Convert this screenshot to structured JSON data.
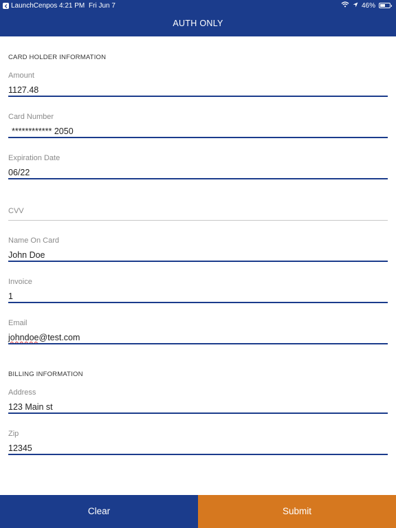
{
  "status_bar": {
    "back_app": "LaunchCenpos",
    "time": "4:21 PM",
    "date": "Fri Jun 7",
    "battery": "46%",
    "battery_level": 0.46
  },
  "header": {
    "title": "AUTH ONLY"
  },
  "card_section": {
    "heading": "CARD HOLDER INFORMATION"
  },
  "fields": {
    "amount": {
      "label": "Amount",
      "value": "1127.48"
    },
    "card_number": {
      "label": "Card Number",
      "value": "************ 2050"
    },
    "expiration": {
      "label": "Expiration Date",
      "value": "06/22"
    },
    "cvv": {
      "label": "CVV",
      "value": ""
    },
    "name": {
      "label": "Name On Card",
      "value": "John Doe"
    },
    "invoice": {
      "label": "Invoice",
      "value": "1"
    },
    "email": {
      "label": "Email",
      "value_part1": "johndoe",
      "value_part2": "@test.com"
    }
  },
  "billing_section": {
    "heading": "BILLING INFORMATION"
  },
  "billing_fields": {
    "address": {
      "label": "Address",
      "value": "123 Main st"
    },
    "zip": {
      "label": "Zip",
      "value": "12345"
    }
  },
  "footer": {
    "clear_label": "Clear",
    "submit_label": "Submit"
  },
  "colors": {
    "primary": "#1b3c8c",
    "accent": "#d6781f"
  }
}
